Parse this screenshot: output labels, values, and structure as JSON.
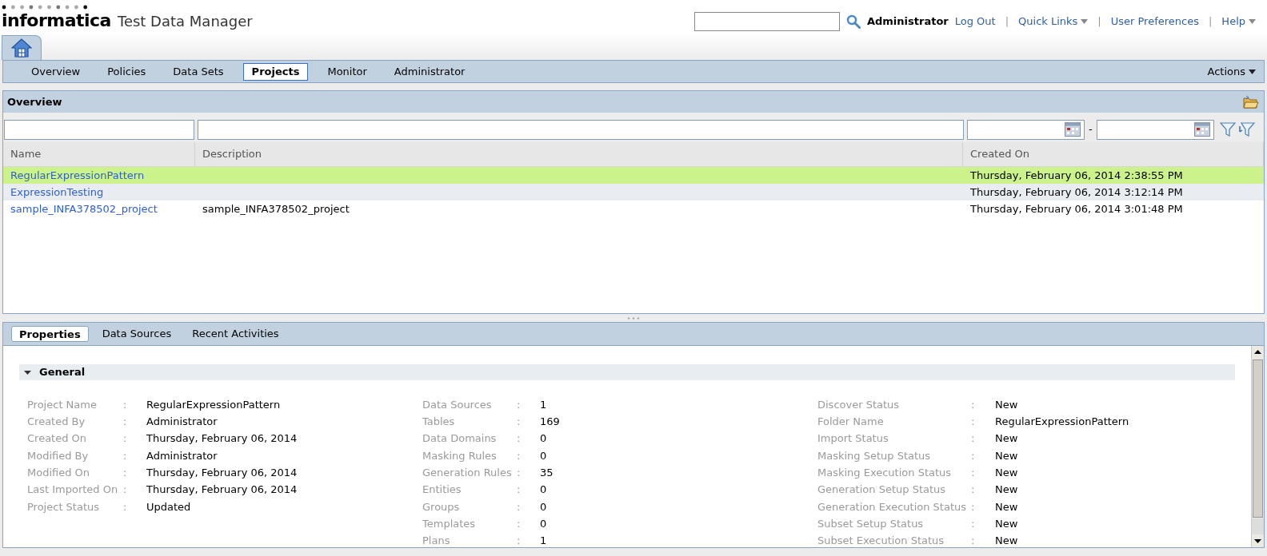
{
  "header": {
    "logo": "informatica",
    "product": "Test Data Manager",
    "user": "Administrator",
    "links": [
      {
        "label": "Log Out",
        "dropdown": false
      },
      {
        "label": "Quick Links",
        "dropdown": true
      },
      {
        "label": "User Preferences",
        "dropdown": false
      },
      {
        "label": "Help",
        "dropdown": true
      }
    ],
    "separator": "|"
  },
  "nav": {
    "tabs": [
      {
        "label": "Overview",
        "selected": false
      },
      {
        "label": "Policies",
        "selected": false
      },
      {
        "label": "Data Sets",
        "selected": false
      },
      {
        "label": "Projects",
        "selected": true
      },
      {
        "label": "Monitor",
        "selected": false
      },
      {
        "label": "Administrator",
        "selected": false
      }
    ],
    "actions": "Actions"
  },
  "overview": {
    "title": "Overview",
    "date_separator": "-",
    "columns": [
      "Name",
      "Description",
      "Created On"
    ],
    "rows": [
      {
        "name": "RegularExpressionPattern",
        "created_on": "Thursday, February 06, 2014 2:38:55 PM",
        "selected": true
      },
      {
        "name": "ExpressionTesting",
        "created_on": "Thursday, February 06, 2014 3:12:14 PM",
        "selected": false
      },
      {
        "name": "sample_INFA378502_project",
        "description": "sample_INFA378502_project",
        "created_on": "Thursday, February 06, 2014 3:01:48 PM",
        "selected": false
      }
    ]
  },
  "details": {
    "tabs": [
      {
        "label": "Properties",
        "selected": true
      },
      {
        "label": "Data Sources",
        "selected": false
      },
      {
        "label": "Recent Activities",
        "selected": false
      }
    ],
    "section": {
      "title": "General",
      "expanded": true
    },
    "columns": [
      [
        {
          "label": "Project Name",
          "sep": ":",
          "value": "RegularExpressionPattern"
        },
        {
          "label": "Created By",
          "sep": ":",
          "value": "Administrator"
        },
        {
          "label": "Created On",
          "sep": ":",
          "value": "Thursday, February 06, 2014"
        },
        {
          "label": "Modified By",
          "sep": ":",
          "value": "Administrator"
        },
        {
          "label": "Modified On",
          "sep": ":",
          "value": "Thursday, February 06, 2014"
        },
        {
          "label": "Last Imported On",
          "sep": ":",
          "value": "Thursday, February 06, 2014"
        },
        {
          "label": "Project Status",
          "sep": ":",
          "value": "Updated"
        }
      ],
      [
        {
          "label": "Data Sources",
          "sep": ":",
          "value": "1"
        },
        {
          "label": "Tables",
          "sep": ":",
          "value": "169"
        },
        {
          "label": "Data Domains",
          "sep": ":",
          "value": "0"
        },
        {
          "label": "Masking Rules",
          "sep": ":",
          "value": "0"
        },
        {
          "label": "Generation Rules",
          "sep": ":",
          "value": "35"
        },
        {
          "label": "Entities",
          "sep": ":",
          "value": "0"
        },
        {
          "label": "Groups",
          "sep": ":",
          "value": "0"
        },
        {
          "label": "Templates",
          "sep": ":",
          "value": "0"
        },
        {
          "label": "Plans",
          "sep": ":",
          "value": "1"
        }
      ],
      [
        {
          "label": "Discover Status",
          "sep": ":",
          "value": "New"
        },
        {
          "label": "Folder Name",
          "sep": ":",
          "value": "RegularExpressionPattern"
        },
        {
          "label": "Import Status",
          "sep": ":",
          "value": "New"
        },
        {
          "label": "Masking Setup Status",
          "sep": ":",
          "value": "New"
        },
        {
          "label": "Masking Execution Status",
          "sep": ":",
          "value": "New"
        },
        {
          "label": "Generation Setup Status",
          "sep": ":",
          "value": "New"
        },
        {
          "label": "Generation Execution Status",
          "sep": ":",
          "value": "New"
        },
        {
          "label": "Subset Setup Status",
          "sep": ":",
          "value": "New"
        },
        {
          "label": "Subset Execution Status",
          "sep": ":",
          "value": "New"
        }
      ]
    ]
  }
}
